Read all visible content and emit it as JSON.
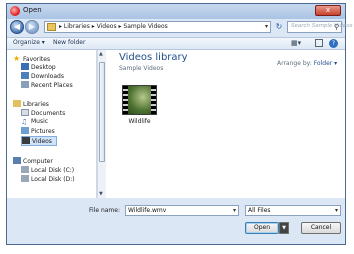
{
  "window": {
    "title": "Open",
    "close_label": "x"
  },
  "address": {
    "path": "▸ Libraries ▸ Videos ▸ Sample Videos",
    "search_placeholder": "Search Sample Videos"
  },
  "toolbar": {
    "organize": "Organize ▾",
    "new_folder": "New folder"
  },
  "nav": {
    "favorites": "Favorites",
    "desktop": "Desktop",
    "downloads": "Downloads",
    "recent": "Recent Places",
    "libraries": "Libraries",
    "documents": "Documents",
    "music": "Music",
    "pictures": "Pictures",
    "videos": "Videos",
    "computer": "Computer",
    "local_c": "Local Disk (C:)",
    "local_d": "Local Disk (D:)"
  },
  "main": {
    "title": "Videos library",
    "subtitle": "Sample Videos",
    "arrange_label": "Arrange by:",
    "arrange_value": "Folder ▾",
    "files": [
      {
        "name": "Wildlife"
      }
    ]
  },
  "bottom": {
    "file_name_label": "File name:",
    "file_name_value": "Wildlife.wmv",
    "filter": "All Files",
    "open_label": "Open",
    "cancel_label": "Cancel"
  },
  "colors": {
    "accent": "#1f4e8c",
    "frame": "#dbe7f5"
  }
}
